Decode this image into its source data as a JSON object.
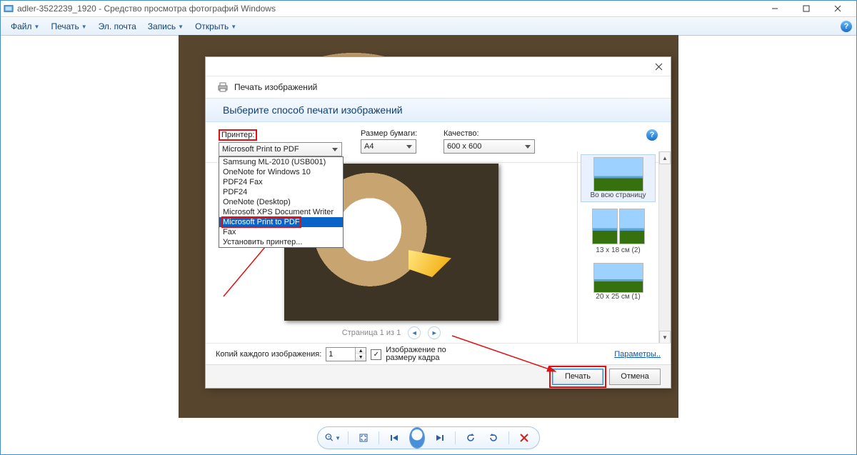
{
  "titlebar": {
    "filename": "adler-3522239_1920",
    "appname": "Средство просмотра фотографий Windows"
  },
  "menubar": {
    "file": "Файл",
    "print": "Печать",
    "email": "Эл. почта",
    "burn": "Запись",
    "open": "Открыть"
  },
  "dialog": {
    "title": "Печать изображений",
    "instruction": "Выберите способ печати изображений",
    "printer_label": "Принтер:",
    "printer_value": "Microsoft Print to PDF",
    "paper_label": "Размер бумаги:",
    "paper_value": "A4",
    "quality_label": "Качество:",
    "quality_value": "600 x 600",
    "printer_options": [
      "Samsung ML-2010 (USB001)",
      "OneNote for Windows 10",
      "PDF24 Fax",
      "PDF24",
      "OneNote (Desktop)",
      "Microsoft XPS Document Writer",
      "Microsoft Print to PDF",
      "Fax",
      "Установить принтер..."
    ],
    "pager_text": "Страница 1 из 1",
    "templates": {
      "full": "Во всю страницу",
      "t2": "13 x 18 см (2)",
      "t3": "20 x 25 см (1)"
    },
    "copies_label": "Копий каждого изображения:",
    "copies_value": "1",
    "fit_label": "Изображение по размеру кадра",
    "options_link": "Параметры..",
    "print_btn": "Печать",
    "cancel_btn": "Отмена"
  }
}
